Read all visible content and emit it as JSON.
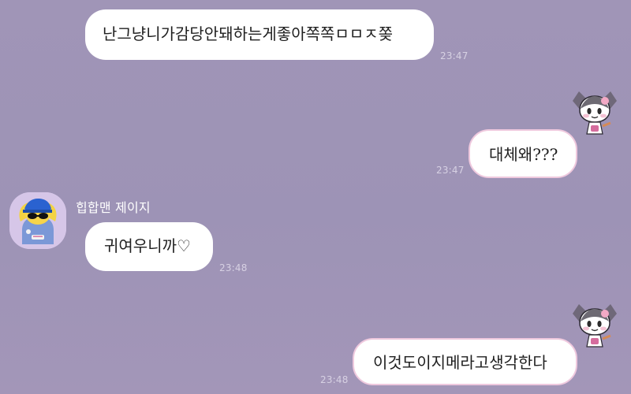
{
  "conversation": {
    "messages": [
      {
        "direction": "incoming",
        "text": "난그냥니가감당안돼하는게좋아쪽쪽ㅁㅁㅈ쫒",
        "time": "23:47"
      },
      {
        "direction": "outgoing",
        "text": "대체왜???",
        "time": "23:47"
      },
      {
        "direction": "incoming",
        "sender": "힙합맨 제이지",
        "text": "귀여우니까♡",
        "time": "23:48"
      },
      {
        "direction": "outgoing",
        "text": "이것도이지메라고생각한다",
        "time": "23:48"
      }
    ]
  },
  "icons": {
    "avatar": "hiphop-character-avatar",
    "sticker": "kuromi-sticker-icon"
  },
  "colors": {
    "background_top": "#a095b7",
    "background_bottom": "#a396b8",
    "bubble_incoming": "#ffffff",
    "bubble_outgoing_border": "#efc9de",
    "timestamp": "#d7d1e3"
  }
}
